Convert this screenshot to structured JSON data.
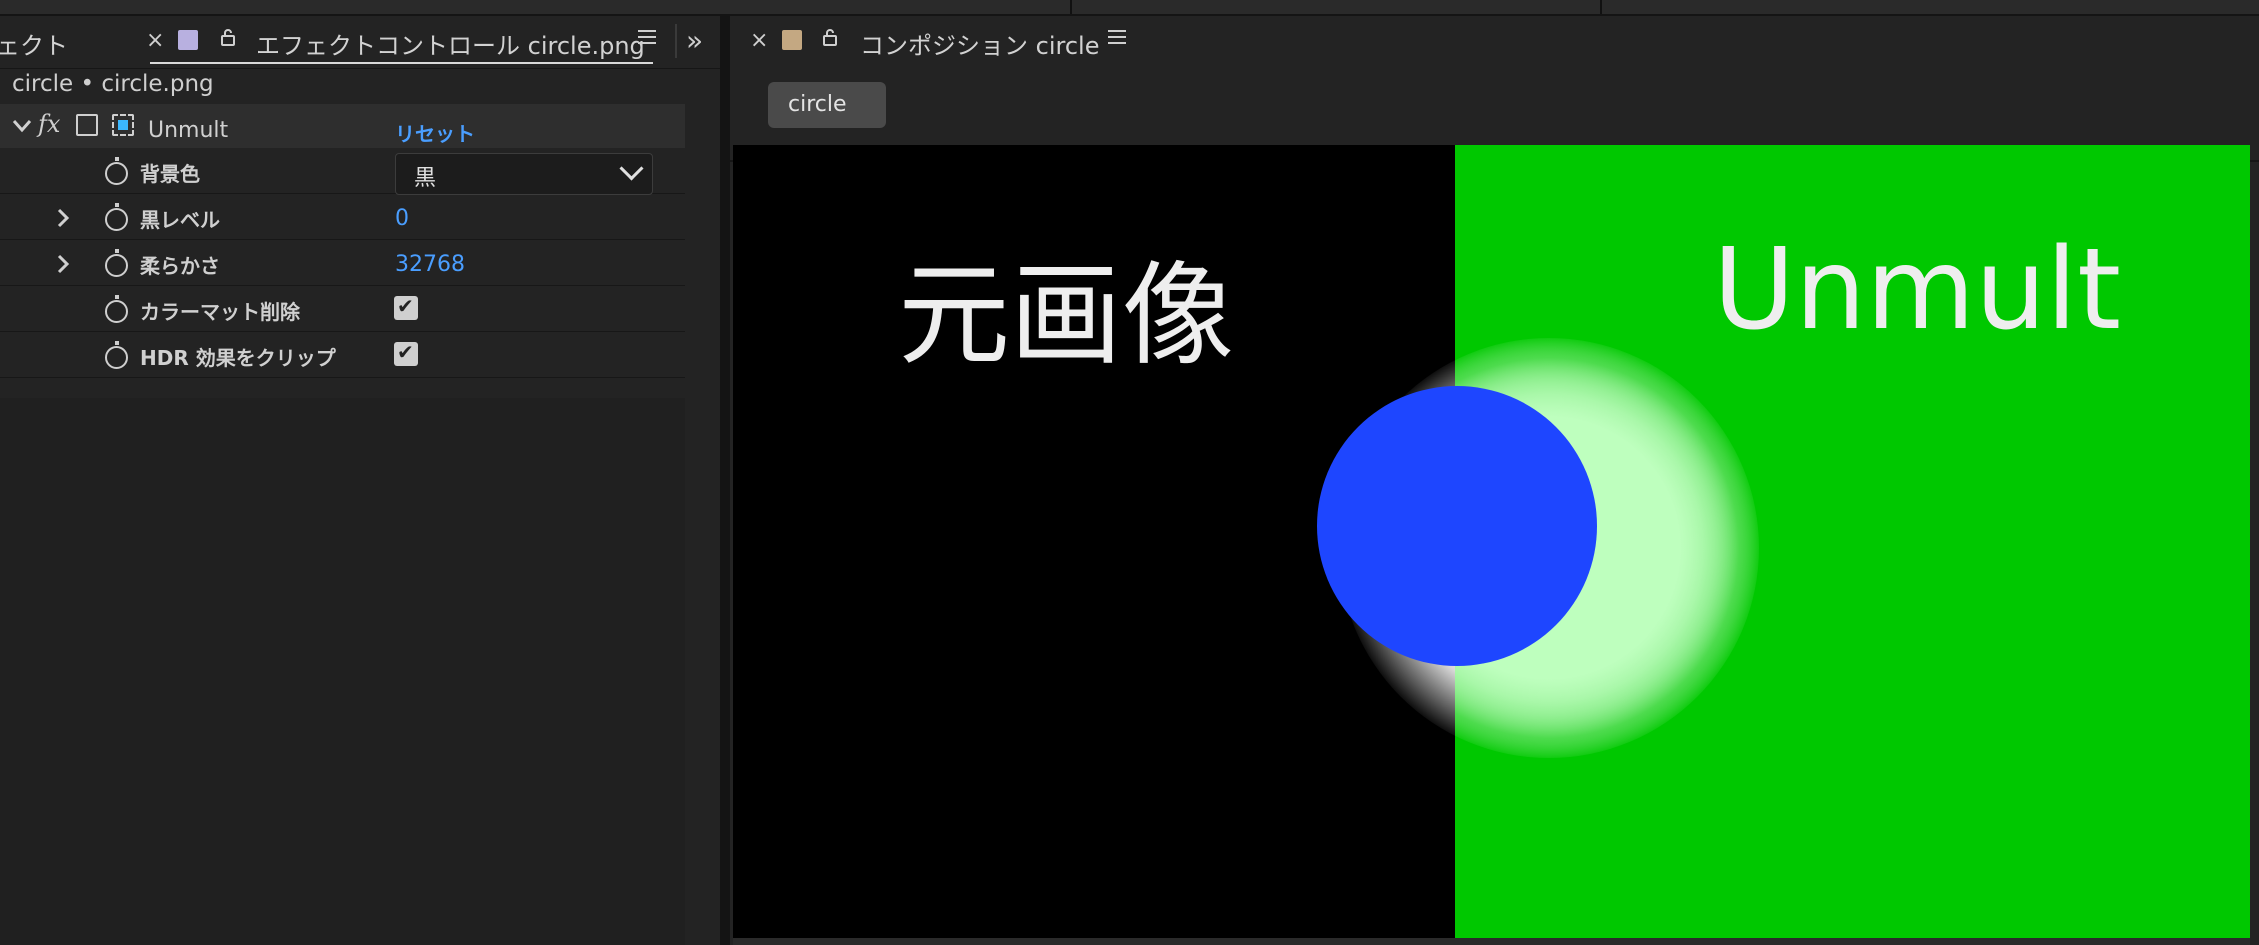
{
  "effects_panel": {
    "tab_prev_label": "ェクト",
    "tab_active_label": "エフェクトコントロール circle.png",
    "subtitle": "circle • circle.png",
    "effect": {
      "name": "Unmult",
      "reset_label": "リセット"
    },
    "properties": [
      {
        "label": "背景色",
        "value": "黒"
      },
      {
        "label": "黒レベル",
        "value": "0"
      },
      {
        "label": "柔らかさ",
        "value": "32768"
      },
      {
        "label": "カラーマット削除",
        "checked": true
      },
      {
        "label": "HDR 効果をクリップ",
        "checked": true
      }
    ],
    "layer_swatch_color": "#b8b0e0"
  },
  "composition_panel": {
    "tab_label": "コンポジション circle",
    "comp_swatch_color": "#c4a882",
    "breadcrumb_pill": "circle",
    "viewer": {
      "left_text": "元画像",
      "right_text": "Unmult",
      "colors": {
        "left_bg": "#000000",
        "right_bg": "#00c800",
        "circle": "#1e46ff"
      }
    }
  },
  "icons": {
    "close": "×",
    "check": "✔",
    "chevron_right": "›",
    "chevron_down": "⌄",
    "double_chevron": "»"
  }
}
